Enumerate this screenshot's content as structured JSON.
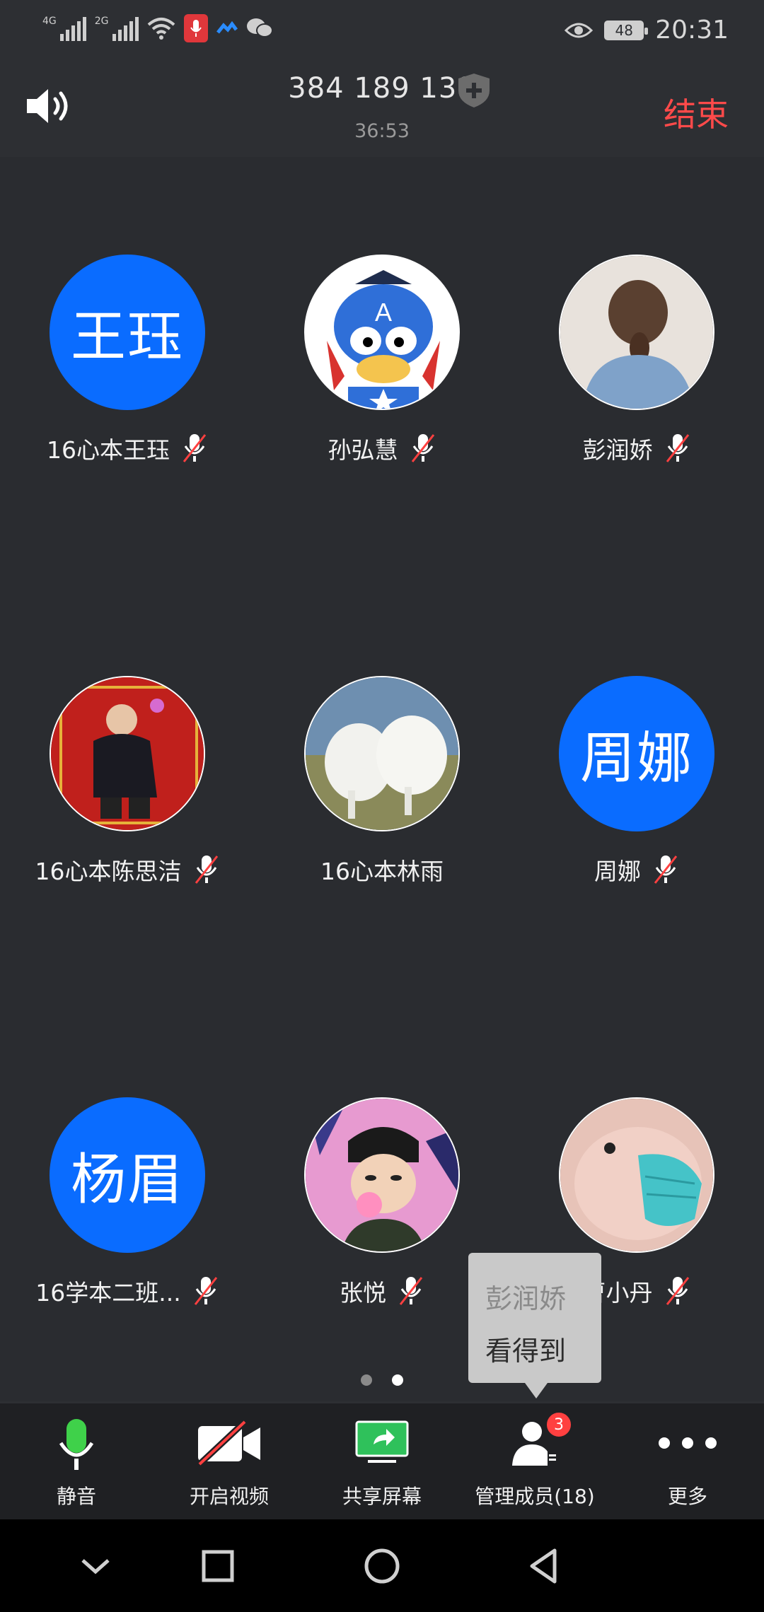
{
  "status_bar": {
    "signal_1_label": "4G",
    "signal_2_label": "2G",
    "battery": "48",
    "time": "20:31",
    "icons": [
      "signal-icon",
      "signal-icon",
      "wifi-icon",
      "mic-recording-icon",
      "app-icon",
      "wechat-icon",
      "eye-icon",
      "battery-icon"
    ]
  },
  "header": {
    "meeting_id": "384 189 138",
    "duration": "36:53",
    "end_label": "结束"
  },
  "participants": [
    {
      "name": "16心本王珏",
      "avatar_text": "王珏",
      "muted": true
    },
    {
      "name": "孙弘慧",
      "avatar_text": "",
      "muted": true
    },
    {
      "name": "彭润娇",
      "avatar_text": "",
      "muted": true
    },
    {
      "name": "16心本陈思洁",
      "avatar_text": "",
      "muted": true
    },
    {
      "name": "16心本林雨",
      "avatar_text": "",
      "muted": false
    },
    {
      "name": "周娜",
      "avatar_text": "周娜",
      "muted": true
    },
    {
      "name": "16学本二班...",
      "avatar_text": "杨眉",
      "muted": true
    },
    {
      "name": "张悦",
      "avatar_text": "",
      "muted": true
    },
    {
      "name": "曹小丹",
      "avatar_text": "",
      "muted": true
    }
  ],
  "popup": {
    "line1": "彭润娇",
    "line2": "看得到"
  },
  "page_dots": {
    "total": 2,
    "active": 2
  },
  "toolbar": {
    "mute_label": "静音",
    "video_label": "开启视频",
    "share_label": "共享屏幕",
    "members_label": "管理成员(18)",
    "members_badge": "3",
    "more_label": "更多"
  },
  "colors": {
    "accent_blue": "#0a6cff",
    "end_red": "#ff4a4a",
    "mic_green": "#3fd14a",
    "share_green": "#2fc15b"
  }
}
